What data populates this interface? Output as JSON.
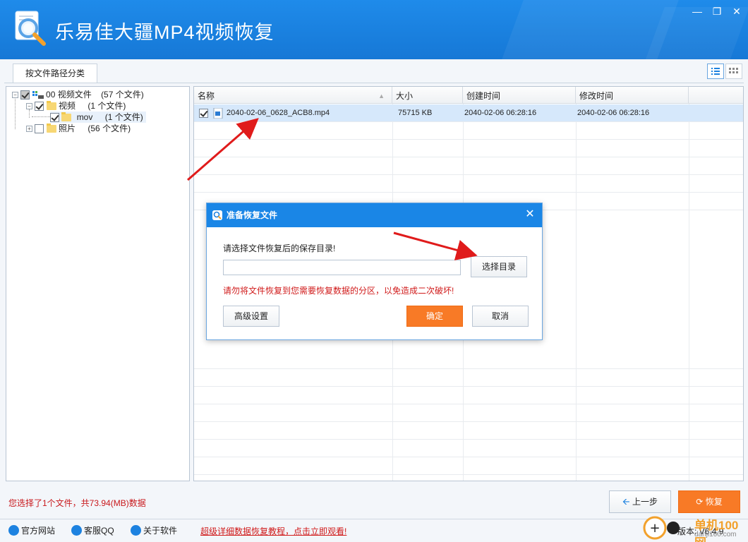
{
  "app": {
    "title": "乐易佳大疆MP4视频恢复"
  },
  "tabs": [
    {
      "label": "按文件路径分类"
    }
  ],
  "tree": {
    "root": {
      "label": "00 视频文件",
      "count": "(57 个文件)"
    },
    "video": {
      "label": "视频",
      "count": "(1 个文件)"
    },
    "mov": {
      "label": "mov",
      "count": "(1 个文件)"
    },
    "photo": {
      "label": "照片",
      "count": "(56 个文件)"
    }
  },
  "list": {
    "headers": {
      "name": "名称",
      "size": "大小",
      "created": "创建时间",
      "modified": "修改时间"
    },
    "rows": [
      {
        "name": "2040-02-06_0628_ACB8.mp4",
        "size": "75715 KB",
        "created": "2040-02-06  06:28:16",
        "modified": "2040-02-06  06:28:16"
      }
    ]
  },
  "dialog": {
    "title": "准备恢复文件",
    "label": "请选择文件恢复后的保存目录!",
    "path_value": "",
    "choose_dir": "选择目录",
    "warning": "请勿将文件恢复到您需要恢复数据的分区，以免造成二次破坏!",
    "advanced": "高级设置",
    "ok": "确定",
    "cancel": "取消"
  },
  "status": {
    "selection": "您选择了1个文件，共73.94(MB)数据"
  },
  "nav": {
    "prev": "上一步",
    "recover": "恢复"
  },
  "footer": {
    "website": "官方网站",
    "qq": "客服QQ",
    "about": "关于软件",
    "promo": "超级详细数据恢复教程，点击立即观看!",
    "version": "版本: V6.4.9"
  },
  "watermark": {
    "text": "单机100网",
    "sub": "danji100.com"
  },
  "colors": {
    "titlebar": "#1678d6",
    "accent_orange": "#f87a26",
    "warning_red": "#d01a1a",
    "selection_bg": "#d6e8fb"
  }
}
